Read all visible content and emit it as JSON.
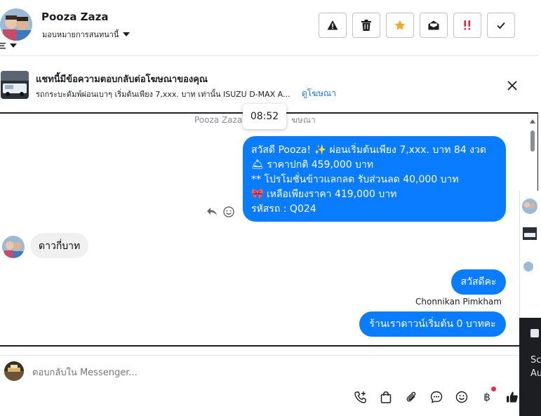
{
  "header": {
    "name": "Pooza Zaza",
    "subtitle": "มอบหมายการสนทนานี้",
    "actions": [
      "warning-icon",
      "trash-icon",
      "star-icon",
      "envelope-open-icon",
      "urgent-icon",
      "check-icon"
    ]
  },
  "ad": {
    "title": "แชทนี้มีข้อความตอบกลับต่อโฆษณาของคุณ",
    "description": "รถกระบะดัมพ์ผ่อนเบาๆ เริ่มต้นเพียง 7,xxx. บาท เท่านั้น ISUZU D-MAX A...",
    "link": "ดูโฆษณา"
  },
  "messages": {
    "ghost_text": "Pooza Zaza",
    "ghost_suffix": "ฆษณา",
    "tooltip_time": "08:52",
    "outgoing_1": {
      "line1": "สวัสดี Pooza! ✨  ผ่อนเริ่มต้นเพียง 7,xxx. บาท 84 งวด",
      "line2": "🛎 ราคาปกติ 459,000 บาท",
      "line3": "** โปรโมชั่นข้าวแลกลด รับส่วนลด 40,000 บาท",
      "line4": "🎀  เหลือเพียงราคา 419,000 บาท",
      "line5": " รหัสรถ : Q024"
    },
    "incoming_1": "ดาวกี่บาท",
    "outgoing_2": "สวัสดีคะ",
    "sender_name": "Chonnikan Pimkham",
    "outgoing_3": "ร้านเราดาวน์เริ่มต้น 0 บาทคะ"
  },
  "composer": {
    "placeholder": "ตอบกลับใน Messenger..."
  },
  "side": {
    "text1": "Sc",
    "text2": "Au"
  },
  "colors": {
    "bubble_out": "#0a7cff",
    "bubble_in": "#f0f0f0",
    "link": "#1877f2",
    "star": "#f5a623",
    "urgent": "#e41e3f"
  }
}
